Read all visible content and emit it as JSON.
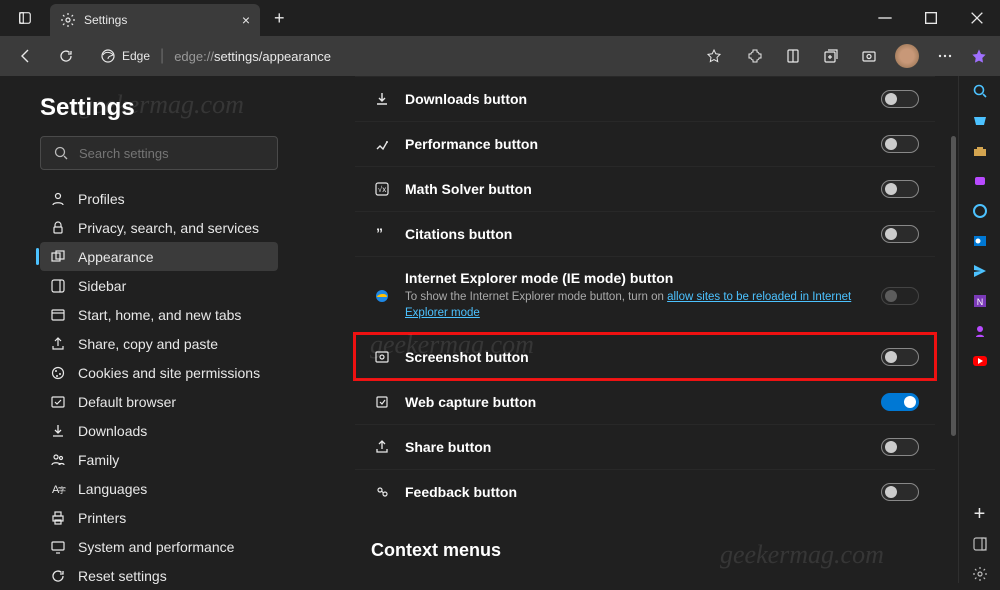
{
  "window": {
    "tab_title": "Settings",
    "url_scheme": "Edge",
    "url_dim": "edge://",
    "url_rest": "settings/appearance"
  },
  "settings": {
    "heading": "Settings",
    "search_placeholder": "Search settings",
    "nav": [
      {
        "label": "Profiles",
        "icon": "profile"
      },
      {
        "label": "Privacy, search, and services",
        "icon": "lock"
      },
      {
        "label": "Appearance",
        "icon": "appearance",
        "active": true
      },
      {
        "label": "Sidebar",
        "icon": "sidebar"
      },
      {
        "label": "Start, home, and new tabs",
        "icon": "home"
      },
      {
        "label": "Share, copy and paste",
        "icon": "share"
      },
      {
        "label": "Cookies and site permissions",
        "icon": "cookies"
      },
      {
        "label": "Default browser",
        "icon": "default"
      },
      {
        "label": "Downloads",
        "icon": "download"
      },
      {
        "label": "Family",
        "icon": "family"
      },
      {
        "label": "Languages",
        "icon": "language"
      },
      {
        "label": "Printers",
        "icon": "printer"
      },
      {
        "label": "System and performance",
        "icon": "system"
      },
      {
        "label": "Reset settings",
        "icon": "reset"
      }
    ]
  },
  "content": {
    "rows": [
      {
        "label": "Downloads button",
        "toggle": false,
        "icon": "download"
      },
      {
        "label": "Performance button",
        "toggle": false,
        "icon": "perf"
      },
      {
        "label": "Math Solver button",
        "toggle": false,
        "icon": "math"
      },
      {
        "label": "Citations button",
        "toggle": false,
        "icon": "cite"
      },
      {
        "label": "Internet Explorer mode (IE mode) button",
        "toggle": false,
        "icon": "ie",
        "disabled": true,
        "sub_pre": "To show the Internet Explorer mode button, turn on ",
        "sub_link": "allow sites to be reloaded in Internet Explorer mode"
      },
      {
        "label": "Screenshot button",
        "toggle": false,
        "icon": "screenshot",
        "highlight": true
      },
      {
        "label": "Web capture button",
        "toggle": true,
        "icon": "capture"
      },
      {
        "label": "Share button",
        "toggle": false,
        "icon": "share2"
      },
      {
        "label": "Feedback button",
        "toggle": false,
        "icon": "feedback"
      }
    ],
    "section_title": "Context menus"
  },
  "watermark": "geekermag.com"
}
